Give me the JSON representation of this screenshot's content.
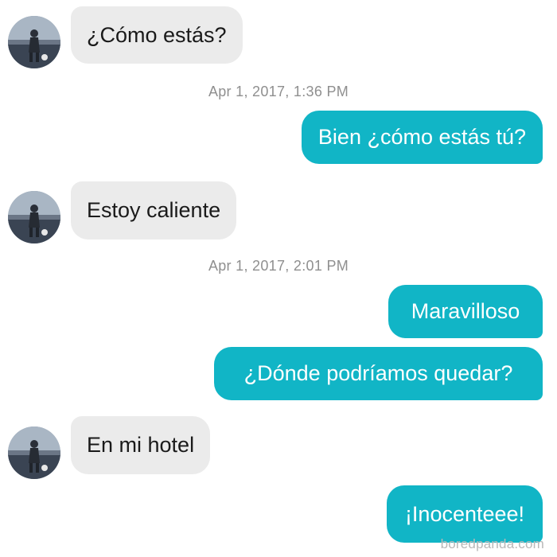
{
  "conversation": {
    "messages": [
      {
        "type": "incoming",
        "text": "¿Cómo estás?"
      },
      {
        "type": "timestamp",
        "text": "Apr 1, 2017, 1:36 PM"
      },
      {
        "type": "outgoing",
        "text": "Bien ¿cómo estás tú?"
      },
      {
        "type": "incoming",
        "text": "Estoy caliente"
      },
      {
        "type": "timestamp",
        "text": "Apr 1, 2017, 2:01 PM"
      },
      {
        "type": "outgoing",
        "text": "Maravilloso"
      },
      {
        "type": "outgoing",
        "text": "¿Dónde podríamos quedar?"
      },
      {
        "type": "incoming",
        "text": "En mi hotel"
      },
      {
        "type": "outgoing",
        "text": "¡Inocenteee!"
      }
    ]
  },
  "watermark": "boredpanda.com",
  "colors": {
    "incoming_bubble": "#ebebeb",
    "outgoing_bubble": "#11b5c6",
    "timestamp_text": "#8f8f8f",
    "background": "#ffffff"
  }
}
